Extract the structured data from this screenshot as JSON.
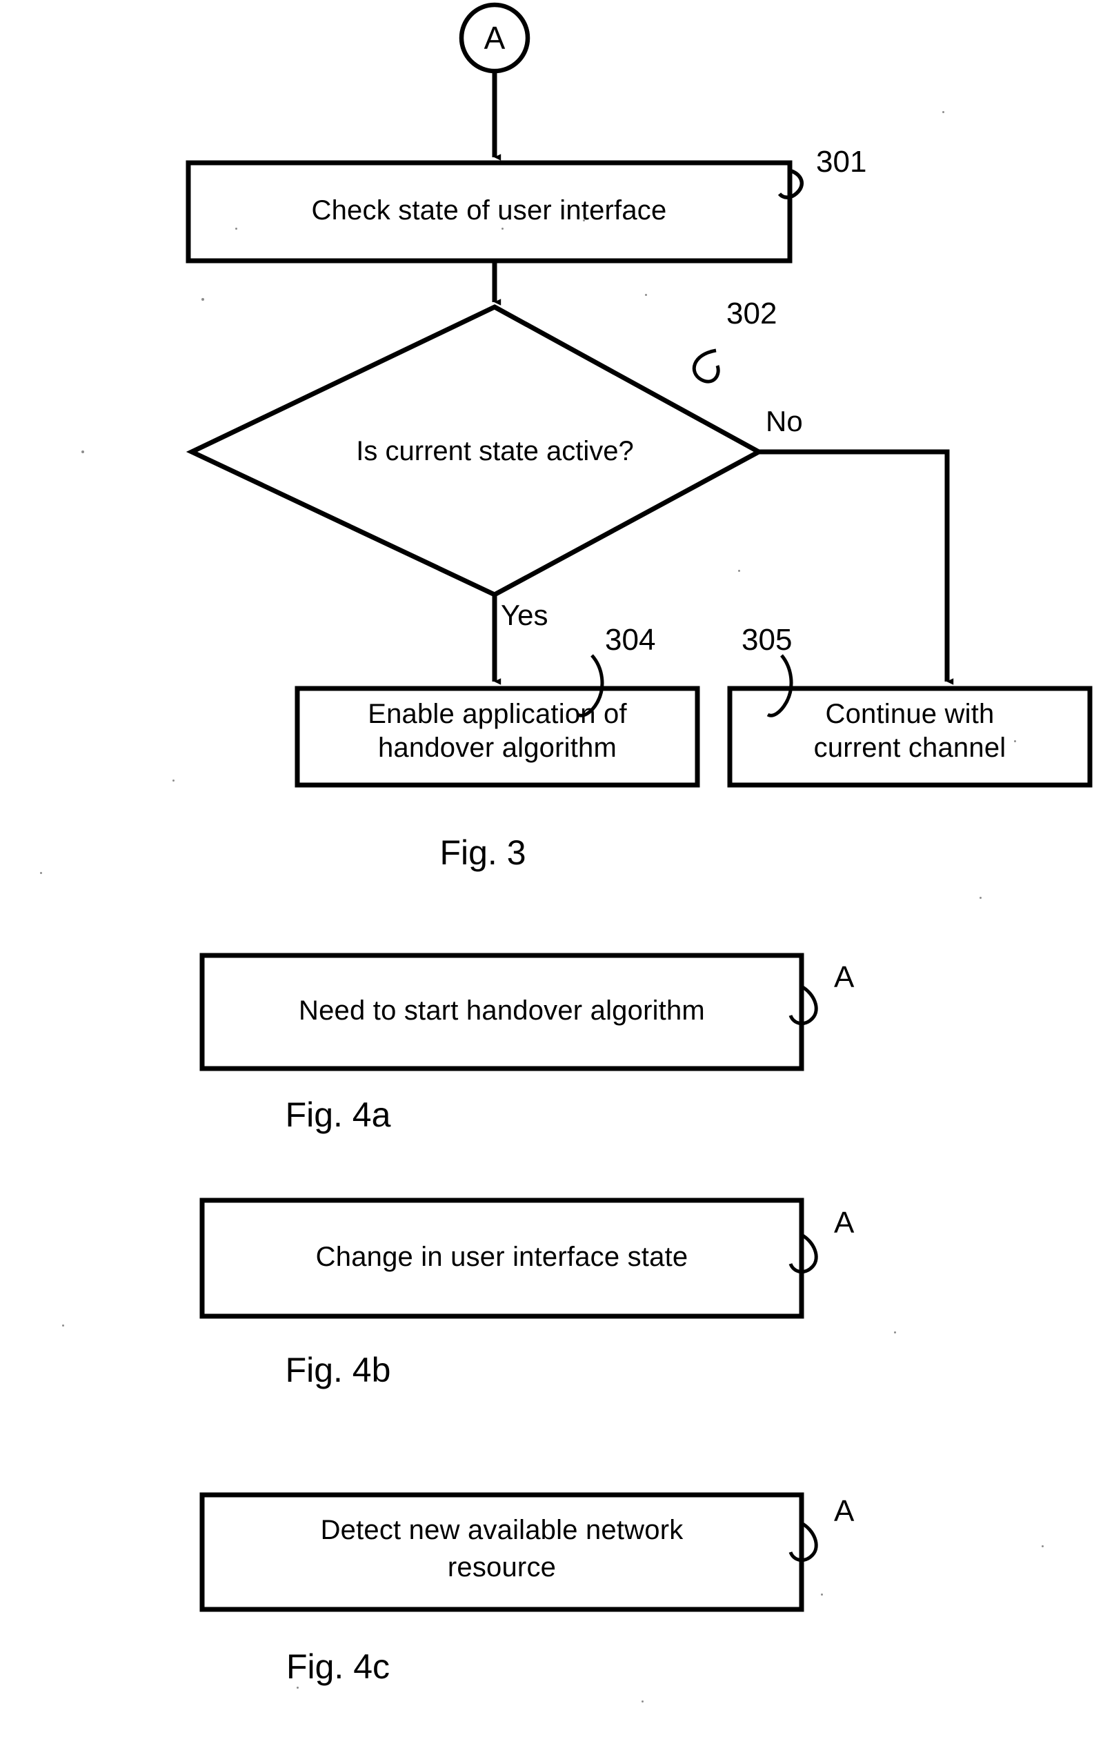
{
  "figure": {
    "kind": "patent-flowchart",
    "ink_color": "#000000",
    "background_color": "#ffffff"
  },
  "fig3": {
    "caption": "Fig. 3",
    "connector_in": {
      "label": "A"
    },
    "steps": [
      {
        "ref": "301",
        "text": "Check state of user interface",
        "shape": "process"
      },
      {
        "ref": "302",
        "text": "Is current state active?",
        "shape": "decision"
      },
      {
        "ref": "304",
        "line1": "Enable application of",
        "line2": "handover algorithm",
        "shape": "process"
      },
      {
        "ref": "305",
        "line1": "Continue with",
        "line2": "current channel",
        "shape": "process"
      }
    ],
    "branches": {
      "yes": "Yes",
      "no": "No"
    }
  },
  "fig4a": {
    "caption": "Fig. 4a",
    "box_text": "Need to start handover algorithm",
    "connector_out": "A"
  },
  "fig4b": {
    "caption": "Fig. 4b",
    "box_text": "Change in user interface state",
    "connector_out": "A"
  },
  "fig4c": {
    "caption": "Fig. 4c",
    "box_line1": "Detect new available network",
    "box_line2": "resource",
    "connector_out": "A"
  }
}
